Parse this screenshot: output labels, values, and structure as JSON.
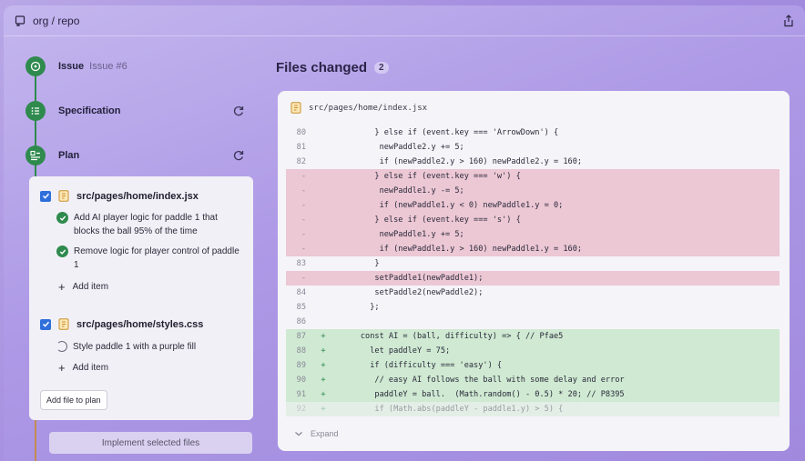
{
  "window": {
    "repo_path": "org / repo"
  },
  "timeline": {
    "issue": {
      "label": "Issue",
      "sub": "Issue #6"
    },
    "specification": {
      "label": "Specification"
    },
    "plan": {
      "label": "Plan"
    }
  },
  "plan_card": {
    "files": [
      {
        "name": "src/pages/home/index.jsx",
        "tasks": [
          {
            "text": "Add AI player logic for paddle 1 that blocks the ball 95% of the time",
            "status": "done"
          },
          {
            "text": "Remove logic for player control of paddle 1",
            "status": "done"
          }
        ],
        "add_item": "Add item"
      },
      {
        "name": "src/pages/home/styles.css",
        "tasks": [
          {
            "text": "Style paddle 1 with a purple fill",
            "status": "pending"
          }
        ],
        "add_item": "Add item"
      }
    ],
    "add_file_label": "Add file to plan",
    "implement_label": "Implement selected files"
  },
  "files_changed": {
    "title": "Files changed",
    "count": "2",
    "file": "src/pages/home/index.jsx",
    "expand_label": "Expand",
    "lines": [
      {
        "n": "80",
        "s": "",
        "t": "normal",
        "code": "        } else if (event.key === 'ArrowDown') {"
      },
      {
        "n": "81",
        "s": "",
        "t": "normal",
        "code": "         newPaddle2.y += 5;"
      },
      {
        "n": "82",
        "s": "",
        "t": "normal",
        "code": "         if (newPaddle2.y > 160) newPaddle2.y = 160;"
      },
      {
        "n": "-",
        "s": "",
        "t": "del",
        "code": "        } else if (event.key === 'w') {"
      },
      {
        "n": "-",
        "s": "",
        "t": "del",
        "code": "         newPaddle1.y -= 5;"
      },
      {
        "n": "-",
        "s": "",
        "t": "del",
        "code": "         if (newPaddle1.y < 0) newPaddle1.y = 0;"
      },
      {
        "n": "-",
        "s": "",
        "t": "del",
        "code": "        } else if (event.key === 's') {"
      },
      {
        "n": "-",
        "s": "",
        "t": "del",
        "code": "         newPaddle1.y += 5;"
      },
      {
        "n": "-",
        "s": "",
        "t": "del",
        "code": "         if (newPaddle1.y > 160) newPaddle1.y = 160;"
      },
      {
        "n": "83",
        "s": "",
        "t": "normal",
        "code": "        }"
      },
      {
        "n": "-",
        "s": "",
        "t": "del",
        "code": "        setPaddle1(newPaddle1);"
      },
      {
        "n": "84",
        "s": "",
        "t": "normal",
        "code": "        setPaddle2(newPaddle2);"
      },
      {
        "n": "85",
        "s": "",
        "t": "normal",
        "code": "       };"
      },
      {
        "n": "86",
        "s": "",
        "t": "normal",
        "code": ""
      },
      {
        "n": "87",
        "s": "+",
        "t": "add",
        "code": "     const AI = (ball, difficulty) => { // Pfae5"
      },
      {
        "n": "88",
        "s": "+",
        "t": "add",
        "code": "       let paddleY = 75;"
      },
      {
        "n": "89",
        "s": "+",
        "t": "add",
        "code": "       if (difficulty === 'easy') {"
      },
      {
        "n": "90",
        "s": "+",
        "t": "add",
        "code": "        // easy AI follows the ball with some delay and error"
      },
      {
        "n": "91",
        "s": "+",
        "t": "add",
        "code": "        paddleY = ball.  (Math.random() - 0.5) * 20; // P8395"
      },
      {
        "n": "92",
        "s": "+",
        "t": "add-faded",
        "code": "        if (Math.abs(paddleY - paddle1.y) > 5) {"
      }
    ]
  }
}
